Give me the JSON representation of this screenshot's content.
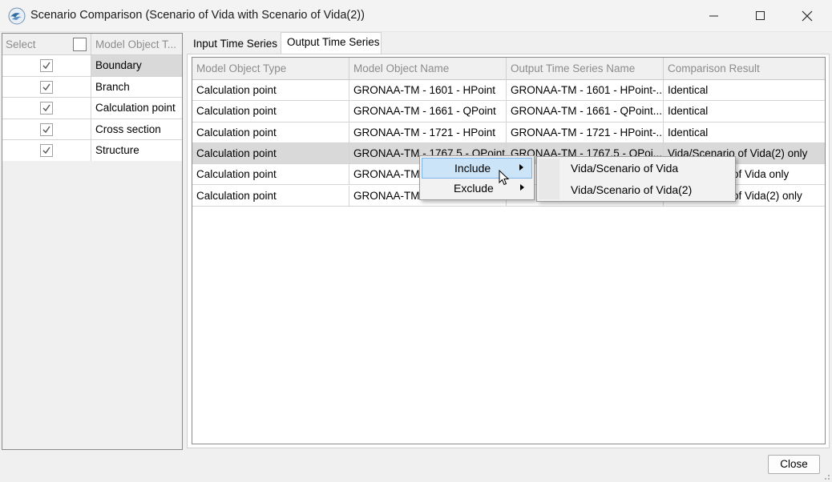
{
  "window": {
    "title": "Scenario Comparison (Scenario of Vida with Scenario of Vida(2))"
  },
  "left_panel": {
    "header_select": "Select",
    "header_type": "Model Object T...",
    "items": [
      {
        "label": "Boundary",
        "checked": true,
        "selected": true
      },
      {
        "label": "Branch",
        "checked": true,
        "selected": false
      },
      {
        "label": "Calculation point",
        "checked": true,
        "selected": false
      },
      {
        "label": "Cross section",
        "checked": true,
        "selected": false
      },
      {
        "label": "Structure",
        "checked": true,
        "selected": false
      }
    ]
  },
  "tabs": [
    {
      "label": "Input Time Series",
      "active": false
    },
    {
      "label": "Output Time Series",
      "active": true
    }
  ],
  "grid": {
    "columns": [
      "Model Object Type",
      "Model Object Name",
      "Output Time Series Name",
      "Comparison Result"
    ],
    "rows": [
      [
        "Calculation point",
        "GRONAA-TM - 1601 - HPoint",
        "GRONAA-TM - 1601 - HPoint-...",
        "Identical"
      ],
      [
        "Calculation point",
        "GRONAA-TM - 1661 - QPoint",
        "GRONAA-TM - 1661 - QPoint...",
        "Identical"
      ],
      [
        "Calculation point",
        "GRONAA-TM - 1721 - HPoint",
        "GRONAA-TM - 1721 - HPoint-...",
        "Identical"
      ],
      [
        "Calculation point",
        "GRONAA-TM - 1767.5 - QPoint",
        "GRONAA-TM - 1767.5 - QPoi...",
        "Vida/Scenario of Vida(2) only"
      ],
      [
        "Calculation point",
        "GRONAA-TM",
        "",
        "of Vida only"
      ],
      [
        "Calculation point",
        "GRONAA-TM",
        "",
        "of Vida(2) only"
      ]
    ],
    "selected_row": 3
  },
  "context_menu": {
    "items": [
      {
        "label": "Include",
        "highlighted": true
      },
      {
        "label": "Exclude",
        "highlighted": false
      }
    ]
  },
  "submenu": {
    "items": [
      {
        "label": "Vida/Scenario of Vida"
      },
      {
        "label": "Vida/Scenario of Vida(2)"
      }
    ]
  },
  "buttons": {
    "close": "Close"
  }
}
